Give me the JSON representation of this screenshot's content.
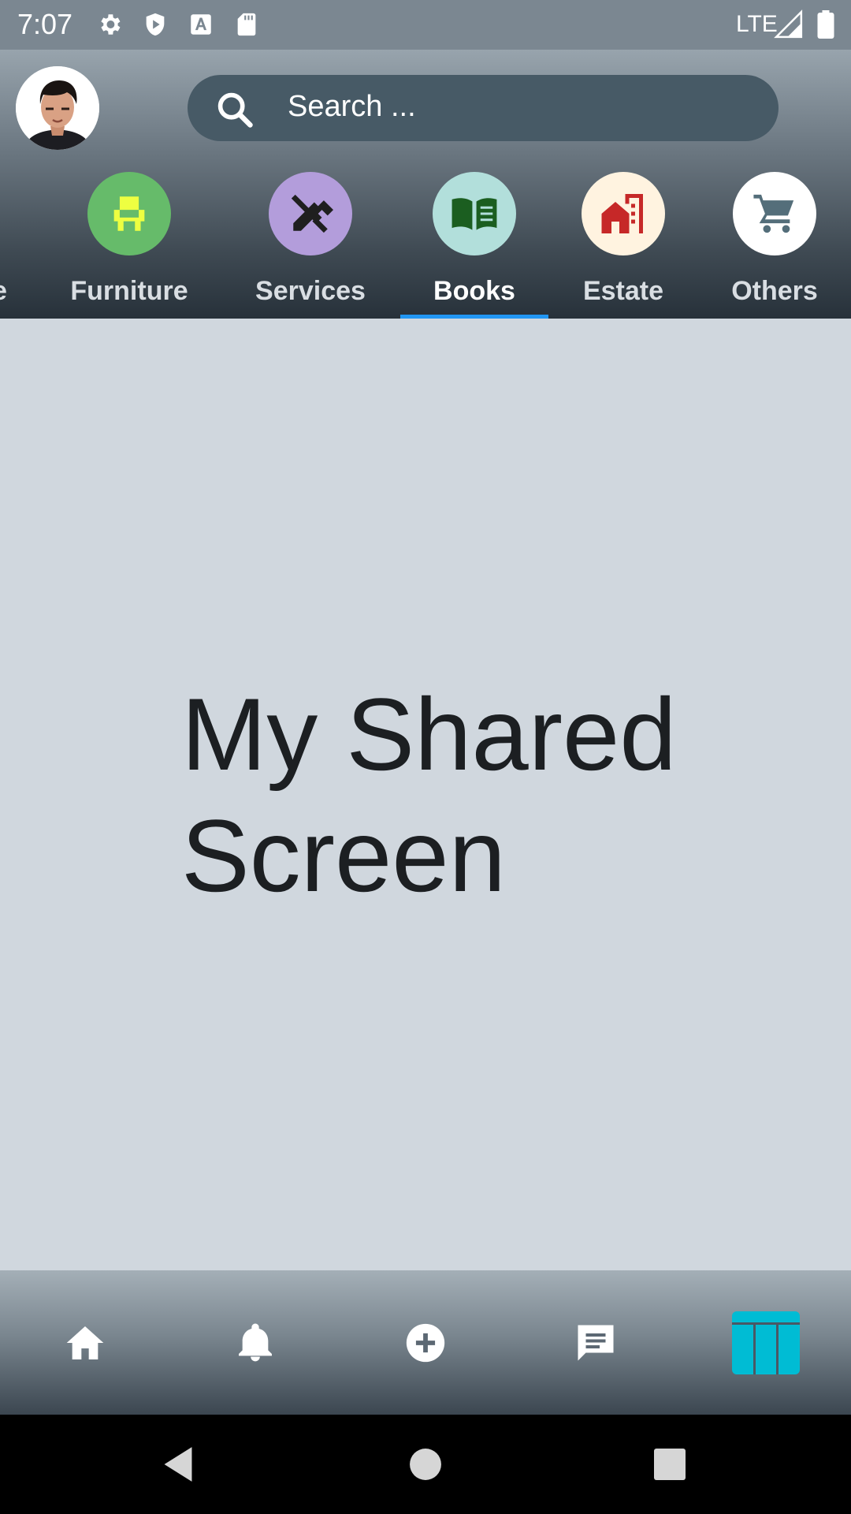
{
  "status_bar": {
    "time": "7:07",
    "network": "LTE",
    "icons": [
      "settings-icon",
      "shield-play-icon",
      "font-a-icon",
      "sd-card-icon",
      "signal-icon",
      "battery-icon"
    ]
  },
  "header": {
    "avatar": "user-avatar",
    "search": {
      "placeholder": "Search ..."
    },
    "partial_tab_label": "e",
    "tabs": [
      {
        "label": "Furniture",
        "icon": "armchair-icon",
        "circle_color": "#66bb6a",
        "icon_color": "#eeff41"
      },
      {
        "label": "Services",
        "icon": "tools-icon",
        "circle_color": "#b39ddb",
        "icon_color": "#1f1f1f"
      },
      {
        "label": "Books",
        "icon": "open-book-icon",
        "circle_color": "#b2dfdb",
        "icon_color": "#1b5e20",
        "active": true
      },
      {
        "label": "Estate",
        "icon": "house-building-icon",
        "circle_color": "#fff3e0",
        "icon_color": "#c62828"
      },
      {
        "label": "Others",
        "icon": "cart-icon",
        "circle_color": "#ffffff",
        "icon_color": "#546e7a"
      }
    ],
    "active_indicator_color": "#2196f3"
  },
  "main": {
    "title": "My Shared Screen"
  },
  "bottom_nav": {
    "items": [
      "home-icon",
      "bell-icon",
      "add-circle-icon",
      "chat-icon",
      "shared-screen-icon"
    ],
    "active_index": 4,
    "active_color": "#00bcd4"
  },
  "system_nav": [
    "back-icon",
    "home-circle-icon",
    "recents-icon"
  ]
}
